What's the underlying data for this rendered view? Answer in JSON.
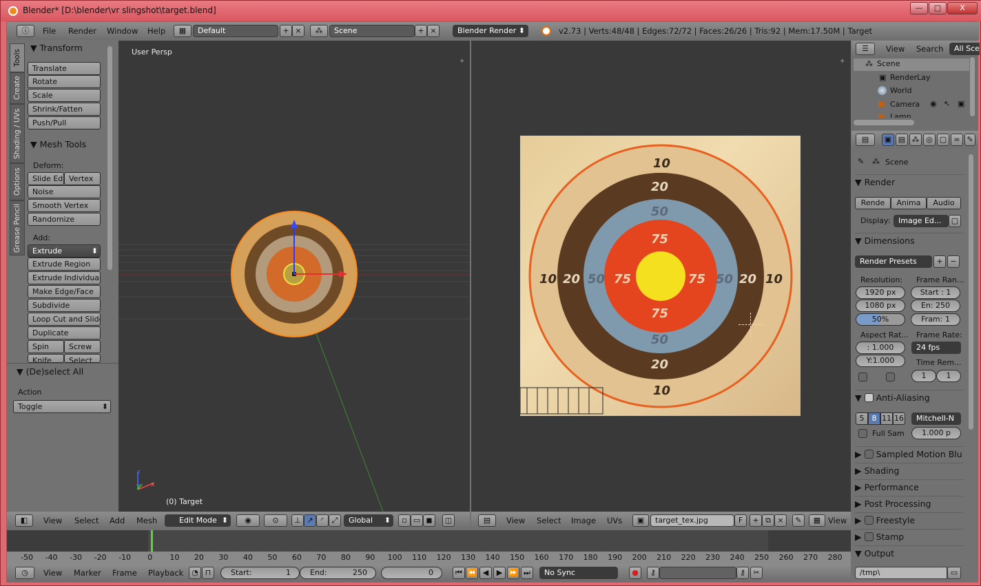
{
  "window": {
    "title": "Blender* [D:\\blender\\vr slingshot\\target.blend]",
    "min": "—",
    "max": "□",
    "close": "X"
  },
  "topbar": {
    "menus": [
      "File",
      "Render",
      "Window",
      "Help"
    ],
    "layout": "Default",
    "scene": "Scene",
    "engine": "Blender Render",
    "stats": "v2.73 | Verts:48/48 | Edges:72/72 | Faces:26/26 | Tris:92 | Mem:17.50M | Target"
  },
  "tools": {
    "tabs": [
      "Tools",
      "Create",
      "Shading / UVs",
      "Options",
      "Grease Pencil"
    ],
    "transform_title": "Transform",
    "transform": [
      "Translate",
      "Rotate",
      "Scale",
      "Shrink/Fatten",
      "Push/Pull"
    ],
    "mesh_tools_title": "Mesh Tools",
    "deform_label": "Deform:",
    "slide_edge": "Slide Ed",
    "vertex": "Vertex",
    "noise": "Noise",
    "smooth_vertex": "Smooth Vertex",
    "randomize": "Randomize",
    "add_label": "Add:",
    "extrude": "Extrude",
    "add_items": [
      "Extrude Region",
      "Extrude Individual",
      "Make Edge/Face",
      "Subdivide",
      "Loop Cut and Slide",
      "Duplicate"
    ],
    "spin": "Spin",
    "screw": "Screw",
    "knife": "Knife",
    "select": "Select",
    "op_title": "(De)select All",
    "action_label": "Action",
    "action_value": "Toggle"
  },
  "viewport3d": {
    "label": "User Persp",
    "object_label": "(0) Target",
    "axis_x": "x",
    "axis_y": "y",
    "axis_z": "z",
    "header": {
      "menus": [
        "View",
        "Select",
        "Add",
        "Mesh"
      ],
      "mode": "Edit Mode",
      "orientation": "Global"
    }
  },
  "target_labels": {
    "outer": "10",
    "ring2": "20",
    "ring3": "50",
    "ring4": "75"
  },
  "image_editor": {
    "header": {
      "menus": [
        "View",
        "Select",
        "Image",
        "UVs"
      ],
      "image_name": "target_tex.jpg",
      "fake_user": "F",
      "view": "View"
    }
  },
  "outliner": {
    "menus": [
      "View",
      "Search"
    ],
    "filter": "All Sce",
    "items": [
      "Scene",
      "RenderLay",
      "World",
      "Camera",
      "Lamp"
    ]
  },
  "properties": {
    "context": "Scene",
    "render_title": "Render",
    "render_buttons": [
      "Rende",
      "Anima",
      "Audio"
    ],
    "display_label": "Display:",
    "display_value": "Image Ed...",
    "dimensions_title": "Dimensions",
    "presets": "Render Presets",
    "resolution_label": "Resolution:",
    "res_x": "1920 px",
    "res_y": "1080 px",
    "res_pct": "50%",
    "frame_range_label": "Frame Ran...",
    "start": "Start : 1",
    "end": "En: 250",
    "frame_step": "Fram: 1",
    "aspect_label": "Aspect Rat...",
    "aspect_x": ": 1.000",
    "aspect_y": "Y:1.000",
    "frame_rate_label": "Frame Rate:",
    "fps": "24 fps",
    "time_remap_label": "Time Rem...",
    "remap_old": "1",
    "remap_new": "1",
    "aa_title": "Anti-Aliasing",
    "aa_samples": [
      "5",
      "8",
      "11",
      "16"
    ],
    "aa_filter": "Mitchell-N",
    "full_sample": "Full Sam",
    "filter_size": "1.000 p",
    "collapsed": [
      "Sampled Motion Blu",
      "Shading",
      "Performance",
      "Post Processing",
      "Freestyle",
      "Stamp"
    ],
    "output_title": "Output",
    "output_path": "/tmp\\"
  },
  "timeline": {
    "ticks": [
      "-50",
      "-40",
      "-30",
      "-20",
      "-10",
      "0",
      "10",
      "20",
      "30",
      "40",
      "50",
      "60",
      "70",
      "80",
      "90",
      "100",
      "110",
      "120",
      "130",
      "140",
      "150",
      "160",
      "170",
      "180",
      "190",
      "200",
      "210",
      "220",
      "230",
      "240",
      "250",
      "260",
      "270",
      "280"
    ],
    "menus": [
      "View",
      "Marker",
      "Frame",
      "Playback"
    ],
    "start_label": "Start:",
    "start": "1",
    "end_label": "End:",
    "end": "250",
    "current": "0",
    "sync": "No Sync"
  }
}
